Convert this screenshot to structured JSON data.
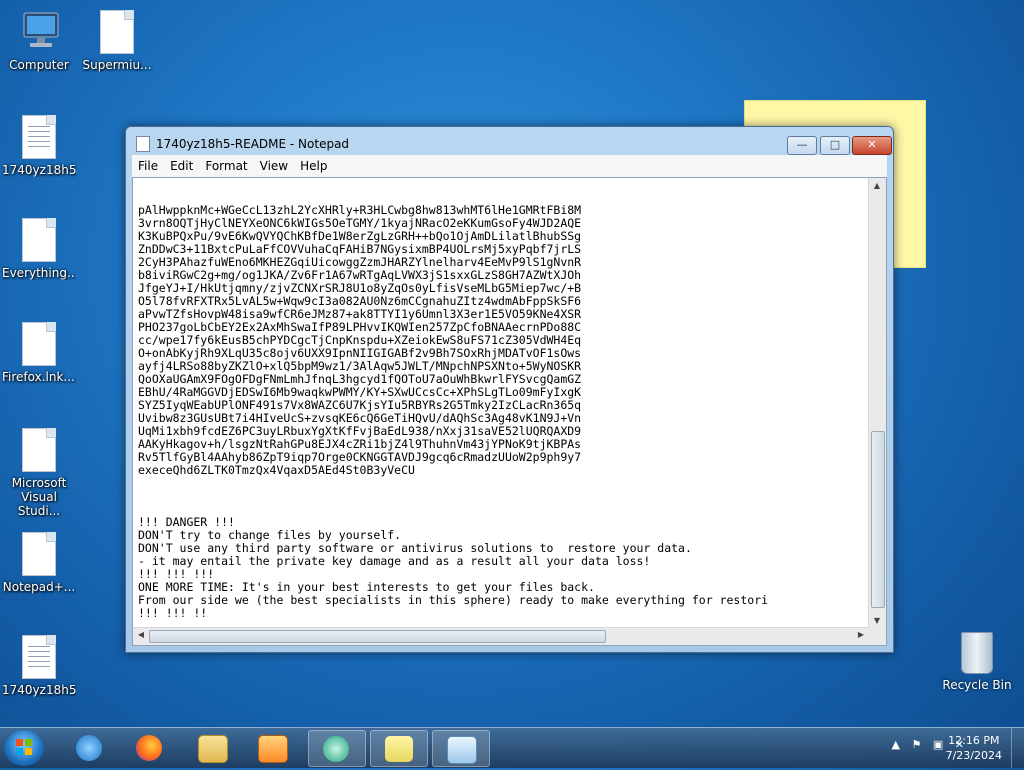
{
  "desktop": {
    "icons": [
      {
        "label": "Computer"
      },
      {
        "label": "Supermiu..."
      },
      {
        "label": "1740yz18h5..."
      },
      {
        "label": "Everything...."
      },
      {
        "label": "Firefox.lnk...."
      },
      {
        "label": "Microsoft Visual Studi..."
      },
      {
        "label": "Notepad+..."
      },
      {
        "label": "1740yz18h5..."
      }
    ],
    "recycle_bin": "Recycle Bin"
  },
  "notepad": {
    "title": "1740yz18h5-README - Notepad",
    "menu": [
      "File",
      "Edit",
      "Format",
      "View",
      "Help"
    ],
    "window_buttons": {
      "minimize": "—",
      "maximize": "□",
      "close": "✕"
    },
    "content": "pAlHwppknMc+WGeCcL13zhL2YcXHRly+R3HLCwbg8hw813whMT6lHe1GMRtFBi8M\n3vrn8OQTjHyClNEYXeONC6kWIGs5OeTGMY/1kyajNRacO2eKKumGsoFy4WJD2AQE\nK3KuBPQxPu/9vE6KwQVYQChKBfDe1W8erZgLzGRH++bQo1OjAmDLilatlBhubSSg\nZnDDwC3+11BxtcPuLaFfCOVVuhaCqFAHiB7NGysixmBP4UOLrsMj5xyPqbf7jrLS\n2CyH3PAhazfuWEno6MKHEZGqiUicowggZzmJHARZYlnelharv4EeMvP9lS1gNvnR\nb8iviRGwC2g+mg/og1JKA/Zv6Fr1A67wRTgAqLVWX3jS1sxxGLzS8GH7AZWtXJOh\nJfgeYJ+I/HkUtjqmny/zjvZCNXrSRJ8U1o8yZqOs0yLfisVseMLbG5Miep7wc/+B\nO5l78fvRFXTRx5LvAL5w+Wqw9cI3a082AU0Nz6mCCgnahuZItz4wdmAbFppSkSF6\naPvwTZfsHovpW48isa9wfCR6eJMz87+ak8TTYI1y6Umnl3X3er1E5VO59KNe4XSR\nPHO237goLbCbEY2Ex2AxMhSwaIfP89LPHvvIKQWIen257ZpCfoBNAAecrnPDo88C\ncc/wpe17fy6kEusB5chPYDCgcTjCnpKnspdu+XZeiokEwS8uFS71cZ305VdWH4Eq\nO+onAbKyjRh9XLqU35c8ojv6UXX9IpnNIIGIGABf2v9Bh7SOxRhjMDATvOF1sOws\nayfj4LRSo88byZKZlO+xlQ5bpM9wz1/3AlAqw5JWLT/MNpchNPSXNto+5WyNOSKR\nQoOXaUGAmX9FOgOFDgFNmLmhJfnqL3hgcyd1fQOToU7aOuWhBkwrlFYSvcgQamGZ\nEBhU/4RaMGGVDjEDSwI6Mb9waqkwPWMY/KY+SXwUCcsCc+XPhSLgTLo09mFyIxgK\nSYZ5IyqWEabUPlONF491s7Vx8WAZC6U7KjsYIu5RBYRs2G5Tmky2IzCLacRn365q\nUvibw8z3GUsUBt7i4HIveUcS+zvsqKE6cQ6GeTiHQvU/dAQhSc3Ag48vK1N9J+Vn\nUqMi1xbh9fcdEZ6PC3uyLRbuxYgXtKfFvjBaEdL938/nXxj31saVE52lUQRQAXD9\nAAKyHkagov+h/lsgzNtRahGPu8EJX4cZRi1bjZ4l9ThuhnVm43jYPNoK9tjKBPAs\nRv5TlfGyBl4AAhyb86ZpT9iqp7Orge0CKNGGTAVDJ9gcq6cRmadzUUoW2p9ph9y7\nexeceQhd6ZLTK0TmzQx4VqaxD5AEd4St0B3yVeCU\n\n\n\n!!! DANGER !!!\nDON'T try to change files by yourself.\nDON'T use any third party software or antivirus solutions to  restore your data.\n- it may entail the private key damage and as a result all your data loss!\n!!! !!! !!!\nONE MORE TIME: It's in your best interests to get your files back.\nFrom our side we (the best specialists in this sphere) ready to make everything for restori\n!!! !!! !!"
  },
  "taskbar": {
    "pinned": [
      "start",
      "internet-explorer",
      "firefox",
      "explorer",
      "media-player",
      "app",
      "sticky-notes",
      "notepad"
    ],
    "clock_time": "12:16 PM",
    "clock_date": "7/23/2024"
  }
}
